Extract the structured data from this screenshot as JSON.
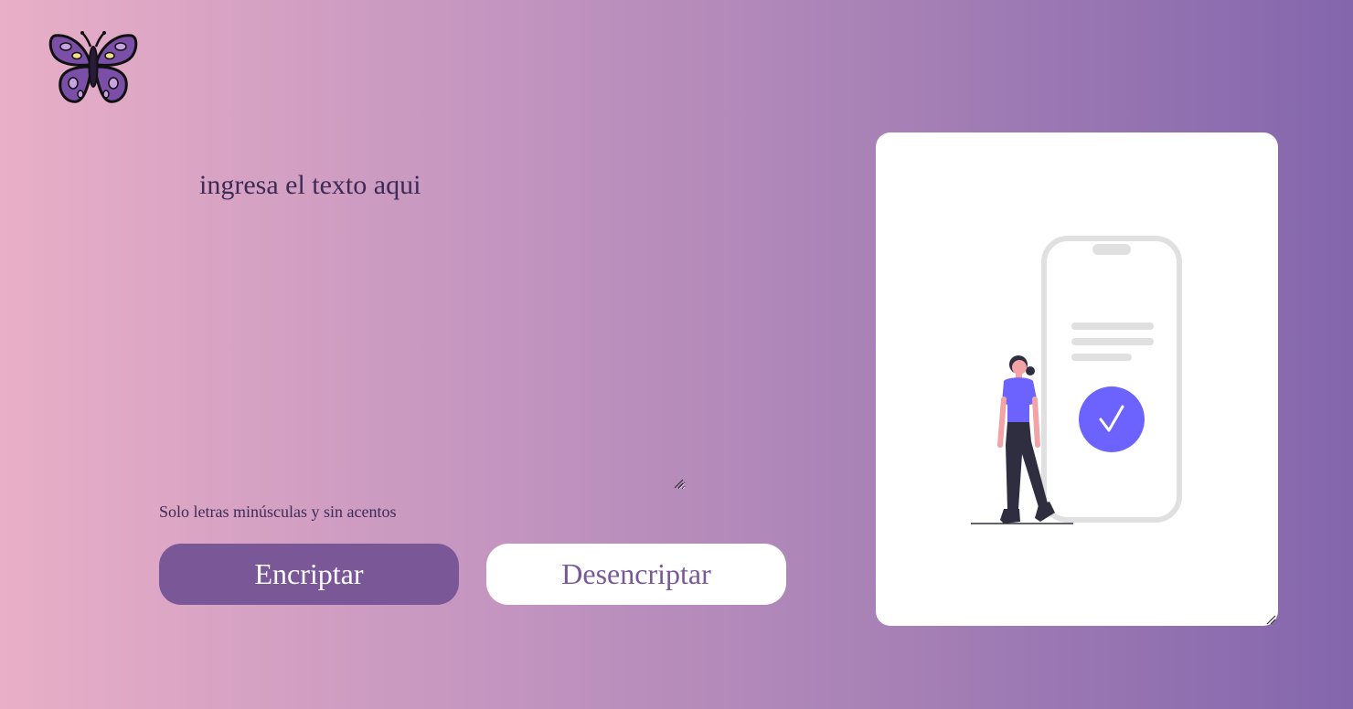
{
  "header": {
    "logo_icon": "butterfly-icon"
  },
  "input": {
    "placeholder": "ingresa el texto aqui",
    "value": ""
  },
  "hint": {
    "text": "Solo letras minúsculas y sin acentos"
  },
  "buttons": {
    "encrypt_label": "Encriptar",
    "decrypt_label": "Desencriptar"
  },
  "output": {
    "illustration_icon": "person-phone-checkmark-icon"
  },
  "colors": {
    "accent": "#7a5898",
    "illustration_purple": "#6c63ff",
    "gradient_start": "#e9afc7",
    "gradient_end": "#8466ad"
  }
}
